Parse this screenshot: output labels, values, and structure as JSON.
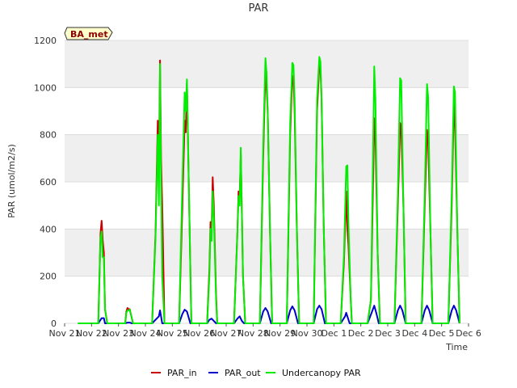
{
  "chart_data": {
    "type": "line",
    "title": "PAR",
    "xlabel": "Time",
    "ylabel": "PAR (umol/m2/s)",
    "ylim": [
      0,
      1200
    ],
    "xlim_days": [
      "Nov 21",
      "Dec 6"
    ],
    "yticks": [
      0,
      200,
      400,
      600,
      800,
      1000,
      1200
    ],
    "xticks": [
      "Nov 21",
      "Nov 22",
      "Nov 23",
      "Nov 24",
      "Nov 25",
      "Nov 26",
      "Nov 27",
      "Nov 28",
      "Nov 29",
      "Nov 30",
      "Dec 1",
      "Dec 2",
      "Dec 3",
      "Dec 4",
      "Dec 5",
      "Dec 6"
    ],
    "grid": true,
    "legend_position": "bottom",
    "annotation": "BA_met",
    "series": [
      {
        "name": "PAR_in",
        "color": "#cc0000",
        "points": [
          [
            "Nov 21 12:00",
            0
          ],
          [
            "Nov 22 06:00",
            0
          ],
          [
            "Nov 22 08:00",
            380
          ],
          [
            "Nov 22 09:00",
            435
          ],
          [
            "Nov 22 10:00",
            350
          ],
          [
            "Nov 22 11:00",
            300
          ],
          [
            "Nov 22 12:00",
            60
          ],
          [
            "Nov 22 14:00",
            0
          ],
          [
            "Nov 23 06:00",
            0
          ],
          [
            "Nov 23 07:00",
            50
          ],
          [
            "Nov 23 08:00",
            65
          ],
          [
            "Nov 23 09:00",
            60
          ],
          [
            "Nov 23 10:00",
            60
          ],
          [
            "Nov 23 11:00",
            40
          ],
          [
            "Nov 23 13:00",
            0
          ],
          [
            "Nov 24 06:00",
            0
          ],
          [
            "Nov 24 09:00",
            380
          ],
          [
            "Nov 24 11:00",
            860
          ],
          [
            "Nov 24 12:00",
            650
          ],
          [
            "Nov 24 13:00",
            1115
          ],
          [
            "Nov 24 14:00",
            700
          ],
          [
            "Nov 24 15:00",
            510
          ],
          [
            "Nov 24 17:00",
            0
          ],
          [
            "Nov 25 06:00",
            0
          ],
          [
            "Nov 25 09:00",
            500
          ],
          [
            "Nov 25 11:00",
            860
          ],
          [
            "Nov 25 12:00",
            810
          ],
          [
            "Nov 25 13:00",
            1020
          ],
          [
            "Nov 25 15:00",
            500
          ],
          [
            "Nov 25 17:00",
            0
          ],
          [
            "Nov 26 07:00",
            0
          ],
          [
            "Nov 26 09:00",
            230
          ],
          [
            "Nov 26 10:00",
            430
          ],
          [
            "Nov 26 11:00",
            380
          ],
          [
            "Nov 26 12:00",
            620
          ],
          [
            "Nov 26 13:00",
            500
          ],
          [
            "Nov 26 15:00",
            120
          ],
          [
            "Nov 26 16:00",
            0
          ],
          [
            "Nov 27 07:00",
            0
          ],
          [
            "Nov 27 10:00",
            390
          ],
          [
            "Nov 27 11:00",
            560
          ],
          [
            "Nov 27 12:00",
            540
          ],
          [
            "Nov 27 13:00",
            720
          ],
          [
            "Nov 27 15:00",
            200
          ],
          [
            "Nov 27 17:00",
            0
          ],
          [
            "Nov 28 06:00",
            0
          ],
          [
            "Nov 28 09:00",
            700
          ],
          [
            "Nov 28 11:00",
            1070
          ],
          [
            "Nov 28 12:00",
            1000
          ],
          [
            "Nov 28 13:00",
            900
          ],
          [
            "Nov 28 15:00",
            400
          ],
          [
            "Nov 28 17:00",
            0
          ],
          [
            "Nov 29 06:00",
            0
          ],
          [
            "Nov 29 09:00",
            800
          ],
          [
            "Nov 29 11:00",
            1050
          ],
          [
            "Nov 29 12:00",
            1040
          ],
          [
            "Nov 29 13:00",
            900
          ],
          [
            "Nov 29 15:00",
            400
          ],
          [
            "Nov 29 17:00",
            0
          ],
          [
            "Nov 30 06:00",
            0
          ],
          [
            "Nov 30 09:00",
            900
          ],
          [
            "Nov 30 11:00",
            1100
          ],
          [
            "Nov 30 12:00",
            1080
          ],
          [
            "Nov 30 13:00",
            950
          ],
          [
            "Nov 30 15:00",
            400
          ],
          [
            "Nov 30 17:00",
            0
          ],
          [
            "Dec 1 06:00",
            0
          ],
          [
            "Dec 1 09:00",
            260
          ],
          [
            "Dec 1 11:00",
            560
          ],
          [
            "Dec 1 12:00",
            400
          ],
          [
            "Dec 1 13:00",
            330
          ],
          [
            "Dec 1 15:00",
            100
          ],
          [
            "Dec 1 16:00",
            0
          ],
          [
            "Dec 2 06:00",
            0
          ],
          [
            "Dec 2 09:00",
            100
          ],
          [
            "Dec 2 12:00",
            870
          ],
          [
            "Dec 2 13:00",
            800
          ],
          [
            "Dec 2 15:00",
            300
          ],
          [
            "Dec 2 17:00",
            0
          ],
          [
            "Dec 3 06:00",
            0
          ],
          [
            "Dec 3 09:00",
            500
          ],
          [
            "Dec 3 11:00",
            850
          ],
          [
            "Dec 3 12:00",
            830
          ],
          [
            "Dec 3 14:00",
            500
          ],
          [
            "Dec 3 16:00",
            0
          ],
          [
            "Dec 4 06:00",
            0
          ],
          [
            "Dec 4 09:00",
            500
          ],
          [
            "Dec 4 11:00",
            820
          ],
          [
            "Dec 4 12:00",
            780
          ],
          [
            "Dec 4 14:00",
            400
          ],
          [
            "Dec 4 16:00",
            0
          ],
          [
            "Dec 5 06:00",
            0
          ],
          [
            "Dec 5 09:00",
            500
          ],
          [
            "Dec 5 11:00",
            935
          ],
          [
            "Dec 5 12:00",
            840
          ],
          [
            "Dec 5 14:00",
            400
          ],
          [
            "Dec 5 16:00",
            0
          ]
        ]
      },
      {
        "name": "PAR_out",
        "color": "#0000cc",
        "points": [
          [
            "Nov 21 12:00",
            0
          ],
          [
            "Nov 22 06:00",
            0
          ],
          [
            "Nov 22 09:00",
            22
          ],
          [
            "Nov 22 11:00",
            22
          ],
          [
            "Nov 22 12:00",
            0
          ],
          [
            "Nov 23 06:00",
            0
          ],
          [
            "Nov 23 08:00",
            3
          ],
          [
            "Nov 23 10:00",
            3
          ],
          [
            "Nov 23 12:00",
            0
          ],
          [
            "Nov 24 06:00",
            0
          ],
          [
            "Nov 24 10:00",
            20
          ],
          [
            "Nov 24 12:00",
            30
          ],
          [
            "Nov 24 13:00",
            55
          ],
          [
            "Nov 24 15:00",
            0
          ],
          [
            "Nov 25 06:00",
            0
          ],
          [
            "Nov 25 09:00",
            40
          ],
          [
            "Nov 25 11:00",
            58
          ],
          [
            "Nov 25 13:00",
            50
          ],
          [
            "Nov 25 16:00",
            0
          ],
          [
            "Nov 26 07:00",
            0
          ],
          [
            "Nov 26 09:00",
            15
          ],
          [
            "Nov 26 11:00",
            20
          ],
          [
            "Nov 26 13:00",
            10
          ],
          [
            "Nov 26 15:00",
            0
          ],
          [
            "Nov 27 07:00",
            0
          ],
          [
            "Nov 27 10:00",
            20
          ],
          [
            "Nov 27 12:00",
            30
          ],
          [
            "Nov 27 14:00",
            10
          ],
          [
            "Nov 27 16:00",
            0
          ],
          [
            "Nov 28 06:00",
            0
          ],
          [
            "Nov 28 09:00",
            50
          ],
          [
            "Nov 28 11:00",
            65
          ],
          [
            "Nov 28 13:00",
            50
          ],
          [
            "Nov 28 16:00",
            0
          ],
          [
            "Nov 29 06:00",
            0
          ],
          [
            "Nov 29 09:00",
            55
          ],
          [
            "Nov 29 11:00",
            72
          ],
          [
            "Nov 29 13:00",
            55
          ],
          [
            "Nov 29 16:00",
            0
          ],
          [
            "Nov 30 06:00",
            0
          ],
          [
            "Nov 30 09:00",
            60
          ],
          [
            "Nov 30 11:00",
            75
          ],
          [
            "Nov 30 13:00",
            60
          ],
          [
            "Nov 30 16:00",
            0
          ],
          [
            "Dec 1 06:00",
            0
          ],
          [
            "Dec 1 10:00",
            30
          ],
          [
            "Dec 1 11:00",
            45
          ],
          [
            "Dec 1 12:00",
            30
          ],
          [
            "Dec 1 14:00",
            0
          ],
          [
            "Dec 2 06:00",
            0
          ],
          [
            "Dec 2 10:00",
            50
          ],
          [
            "Dec 2 12:00",
            75
          ],
          [
            "Dec 2 14:00",
            40
          ],
          [
            "Dec 2 16:00",
            0
          ],
          [
            "Dec 3 06:00",
            0
          ],
          [
            "Dec 3 09:00",
            55
          ],
          [
            "Dec 3 11:00",
            75
          ],
          [
            "Dec 3 13:00",
            55
          ],
          [
            "Dec 3 16:00",
            0
          ],
          [
            "Dec 4 06:00",
            0
          ],
          [
            "Dec 4 09:00",
            55
          ],
          [
            "Dec 4 11:00",
            75
          ],
          [
            "Dec 4 13:00",
            55
          ],
          [
            "Dec 4 16:00",
            0
          ],
          [
            "Dec 5 06:00",
            0
          ],
          [
            "Dec 5 09:00",
            55
          ],
          [
            "Dec 5 11:00",
            75
          ],
          [
            "Dec 5 13:00",
            55
          ],
          [
            "Dec 5 16:00",
            0
          ]
        ]
      },
      {
        "name": "Undercanopy PAR",
        "color": "#00ee00",
        "points": [
          [
            "Nov 21 12:00",
            0
          ],
          [
            "Nov 22 06:00",
            0
          ],
          [
            "Nov 22 08:00",
            360
          ],
          [
            "Nov 22 09:00",
            390
          ],
          [
            "Nov 22 10:00",
            280
          ],
          [
            "Nov 22 11:00",
            280
          ],
          [
            "Nov 22 12:00",
            60
          ],
          [
            "Nov 22 14:00",
            0
          ],
          [
            "Nov 23 06:00",
            0
          ],
          [
            "Nov 23 07:00",
            45
          ],
          [
            "Nov 23 08:00",
            55
          ],
          [
            "Nov 23 09:00",
            55
          ],
          [
            "Nov 23 10:00",
            58
          ],
          [
            "Nov 23 11:00",
            40
          ],
          [
            "Nov 23 13:00",
            0
          ],
          [
            "Nov 24 06:00",
            0
          ],
          [
            "Nov 24 09:00",
            360
          ],
          [
            "Nov 24 11:00",
            800
          ],
          [
            "Nov 24 12:00",
            500
          ],
          [
            "Nov 24 13:00",
            1100
          ],
          [
            "Nov 24 14:00",
            600
          ],
          [
            "Nov 24 15:00",
            200
          ],
          [
            "Nov 24 17:00",
            0
          ],
          [
            "Nov 25 06:00",
            0
          ],
          [
            "Nov 25 09:00",
            600
          ],
          [
            "Nov 25 11:00",
            980
          ],
          [
            "Nov 25 12:00",
            900
          ],
          [
            "Nov 25 13:00",
            1035
          ],
          [
            "Nov 25 15:00",
            500
          ],
          [
            "Nov 25 17:00",
            0
          ],
          [
            "Nov 26 07:00",
            0
          ],
          [
            "Nov 26 09:00",
            200
          ],
          [
            "Nov 26 10:00",
            400
          ],
          [
            "Nov 26 11:00",
            350
          ],
          [
            "Nov 26 12:00",
            560
          ],
          [
            "Nov 26 13:00",
            450
          ],
          [
            "Nov 26 15:00",
            100
          ],
          [
            "Nov 26 16:00",
            0
          ],
          [
            "Nov 27 07:00",
            0
          ],
          [
            "Nov 27 10:00",
            380
          ],
          [
            "Nov 27 11:00",
            540
          ],
          [
            "Nov 27 12:00",
            500
          ],
          [
            "Nov 27 13:00",
            745
          ],
          [
            "Nov 27 15:00",
            200
          ],
          [
            "Nov 27 17:00",
            0
          ],
          [
            "Nov 28 06:00",
            0
          ],
          [
            "Nov 28 09:00",
            750
          ],
          [
            "Nov 28 11:00",
            1125
          ],
          [
            "Nov 28 12:00",
            1060
          ],
          [
            "Nov 28 13:00",
            900
          ],
          [
            "Nov 28 15:00",
            400
          ],
          [
            "Nov 28 17:00",
            0
          ],
          [
            "Nov 29 06:00",
            0
          ],
          [
            "Nov 29 09:00",
            850
          ],
          [
            "Nov 29 11:00",
            1105
          ],
          [
            "Nov 29 12:00",
            1095
          ],
          [
            "Nov 29 13:00",
            950
          ],
          [
            "Nov 29 15:00",
            400
          ],
          [
            "Nov 29 17:00",
            0
          ],
          [
            "Nov 30 06:00",
            0
          ],
          [
            "Nov 30 09:00",
            950
          ],
          [
            "Nov 30 11:00",
            1130
          ],
          [
            "Nov 30 12:00",
            1110
          ],
          [
            "Nov 30 13:00",
            950
          ],
          [
            "Nov 30 15:00",
            400
          ],
          [
            "Nov 30 17:00",
            0
          ],
          [
            "Dec 1 06:00",
            0
          ],
          [
            "Dec 1 09:00",
            290
          ],
          [
            "Dec 1 11:00",
            665
          ],
          [
            "Dec 1 12:00",
            670
          ],
          [
            "Dec 1 13:00",
            420
          ],
          [
            "Dec 1 15:00",
            100
          ],
          [
            "Dec 1 16:00",
            0
          ],
          [
            "Dec 2 06:00",
            0
          ],
          [
            "Dec 2 09:00",
            100
          ],
          [
            "Dec 2 12:00",
            1090
          ],
          [
            "Dec 2 13:00",
            950
          ],
          [
            "Dec 2 15:00",
            300
          ],
          [
            "Dec 2 17:00",
            0
          ],
          [
            "Dec 3 06:00",
            0
          ],
          [
            "Dec 3 09:00",
            550
          ],
          [
            "Dec 3 11:00",
            1040
          ],
          [
            "Dec 3 12:00",
            1030
          ],
          [
            "Dec 3 14:00",
            500
          ],
          [
            "Dec 3 16:00",
            0
          ],
          [
            "Dec 4 06:00",
            0
          ],
          [
            "Dec 4 09:00",
            550
          ],
          [
            "Dec 4 11:00",
            1015
          ],
          [
            "Dec 4 12:00",
            960
          ],
          [
            "Dec 4 14:00",
            400
          ],
          [
            "Dec 4 16:00",
            0
          ],
          [
            "Dec 5 06:00",
            0
          ],
          [
            "Dec 5 09:00",
            550
          ],
          [
            "Dec 5 11:00",
            1005
          ],
          [
            "Dec 5 12:00",
            980
          ],
          [
            "Dec 5 14:00",
            400
          ],
          [
            "Dec 5 16:00",
            0
          ]
        ]
      }
    ]
  }
}
